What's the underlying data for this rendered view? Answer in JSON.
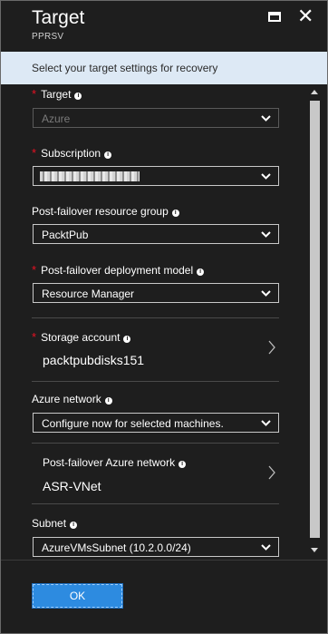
{
  "header": {
    "title": "Target",
    "subtitle": "PPRSV"
  },
  "info_bar": {
    "text": "Select your target settings for recovery"
  },
  "fields": {
    "target": {
      "label": "Target",
      "required": true,
      "value": "Azure",
      "disabled": true
    },
    "subscription": {
      "label": "Subscription",
      "required": true,
      "value": ""
    },
    "resource_group": {
      "label": "Post-failover resource group",
      "required": false,
      "value": "PacktPub"
    },
    "deployment_model": {
      "label": "Post-failover deployment model",
      "required": true,
      "value": "Resource Manager"
    },
    "storage_account": {
      "label": "Storage account",
      "required": true,
      "value": "packtpubdisks151"
    },
    "azure_network": {
      "label": "Azure network",
      "required": false,
      "value": "Configure now for selected machines."
    },
    "failover_network": {
      "label": "Post-failover Azure network",
      "required": false,
      "value": "ASR-VNet"
    },
    "subnet": {
      "label": "Subnet",
      "required": false,
      "value": "AzureVMsSubnet (10.2.0.0/24)"
    }
  },
  "footer": {
    "ok_label": "OK"
  },
  "colors": {
    "background": "#1e1e1e",
    "info_bar": "#dde9f5",
    "required_star": "#e81123",
    "ok_button": "#2d8be0"
  },
  "icons": {
    "info": "info-circle-icon",
    "dropdown": "chevron-down-icon",
    "nav": "chevron-right-icon",
    "maximize": "maximize-icon",
    "close": "close-icon"
  }
}
